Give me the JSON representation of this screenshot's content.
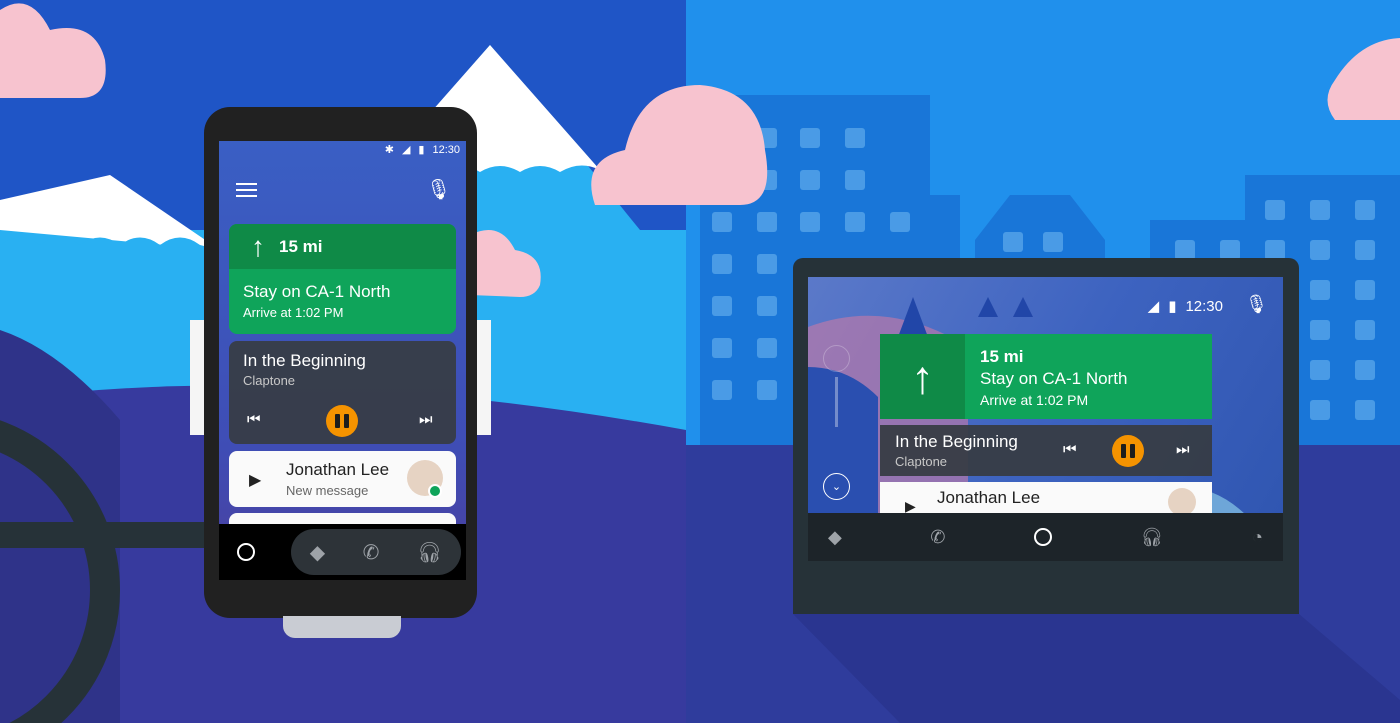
{
  "colors": {
    "nav_green_dark": "#0f8a47",
    "nav_green": "#0fa45a",
    "media_card": "#3a3f46",
    "pause_accent": "#f59300",
    "cloud": "#f7c3cf",
    "device_body": "#212121"
  },
  "phone": {
    "status": {
      "icons": [
        "bluetooth-icon",
        "signal-icon",
        "battery-icon"
      ],
      "time": "12:30"
    },
    "header": {
      "menu_icon": "menu-icon",
      "mic_icon": "mic-icon"
    },
    "nav": {
      "distance": "15 mi",
      "instruction": "Stay on CA-1 North",
      "arrival": "Arrive at 1:02 PM"
    },
    "media": {
      "title": "In the Beginning",
      "artist": "Claptone"
    },
    "message": {
      "name": "Jonathan Lee",
      "subtitle": "New message"
    },
    "bottom_bar": [
      "home-icon",
      "navigation-icon",
      "phone-icon",
      "headphones-icon"
    ]
  },
  "car": {
    "status": {
      "icons": [
        "signal-icon",
        "battery-icon"
      ],
      "time": "12:30"
    },
    "nav": {
      "distance": "15 mi",
      "instruction": "Stay on CA-1 North",
      "arrival": "Arrive at 1:02 PM"
    },
    "media": {
      "title": "In the Beginning",
      "artist": "Claptone"
    },
    "message": {
      "name": "Jonathan Lee"
    },
    "bottom_bar": [
      "navigation-icon",
      "phone-icon",
      "home-icon",
      "headphones-icon",
      "exit-icon"
    ]
  }
}
